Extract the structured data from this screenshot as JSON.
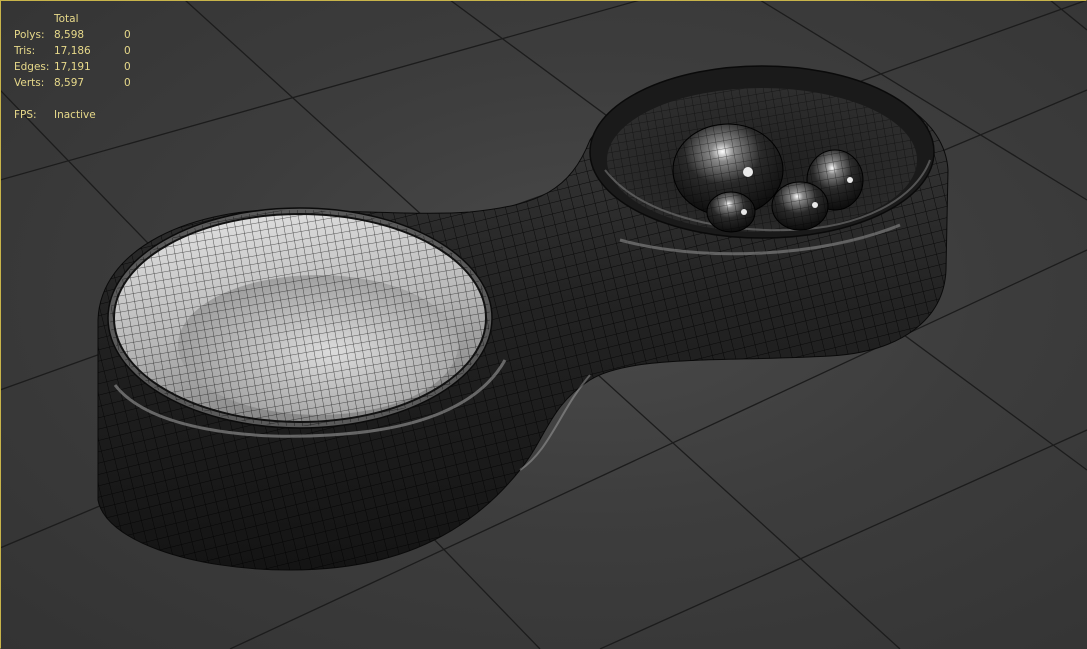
{
  "viewport": {
    "name": "3D Perspective Viewport",
    "background_color": "#3a3a3a",
    "grid_color": "#1c1c1c",
    "model_color": "#262626",
    "wire_color": "#000000",
    "stats_color": "#e7d98a"
  },
  "stats": {
    "header": "Total",
    "rows": [
      {
        "label": "Polys:",
        "total": "8,598",
        "selected": "0"
      },
      {
        "label": "Tris:",
        "total": "17,186",
        "selected": "0"
      },
      {
        "label": "Edges:",
        "total": "17,191",
        "selected": "0"
      },
      {
        "label": "Verts:",
        "total": "8,597",
        "selected": "0"
      }
    ],
    "fps_label": "FPS:",
    "fps_value": "Inactive"
  }
}
